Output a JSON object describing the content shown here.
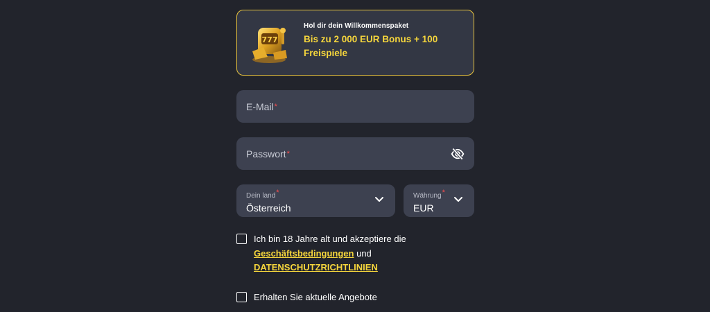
{
  "promo": {
    "subtitle": "Hol dir dein Willkommenspaket",
    "title": "Bis zu 2 000 EUR Bonus + 100 Freispiele",
    "image_icon": "golden-slot-machine-icon"
  },
  "email": {
    "placeholder": "E-Mail",
    "required_mark": "*"
  },
  "password": {
    "placeholder": "Passwort",
    "required_mark": "*",
    "toggle_icon": "eye-slash-icon"
  },
  "country": {
    "label": "Dein land",
    "required_mark": "*",
    "value": "Österreich"
  },
  "currency": {
    "label": "Währung",
    "required_mark": "*",
    "value": "EUR"
  },
  "terms": {
    "text_before": "Ich bin 18 Jahre alt und akzeptiere die",
    "link_terms": "Geschäftsbedingungen",
    "text_and": "und",
    "link_privacy": "DATENSCHUTZRICHTLINIEN"
  },
  "offers": {
    "text": "Erhalten Sie aktuelle Angebote"
  },
  "colors": {
    "background": "#22242c",
    "field": "#3d4150",
    "accent": "#f6d63c",
    "promo_border": "#e8c33e",
    "required": "#ff4d4d"
  }
}
